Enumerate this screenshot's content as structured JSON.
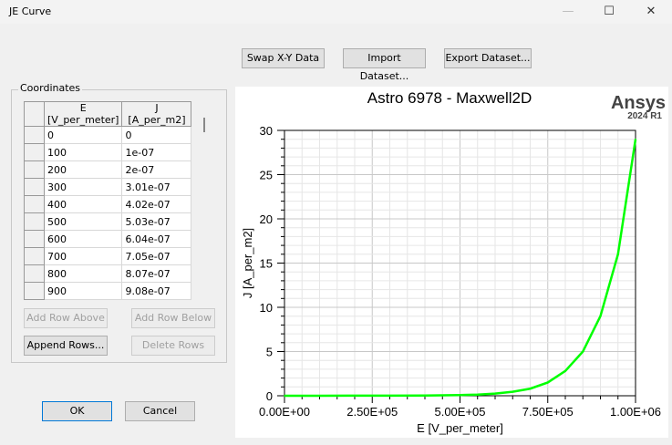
{
  "window": {
    "title": "JE Curve",
    "minimize": "—",
    "maximize": "☐",
    "close": "✕"
  },
  "toolbar": {
    "swap": "Swap X-Y Data",
    "import": "Import Dataset...",
    "export": "Export Dataset..."
  },
  "coordinates": {
    "label": "Coordinates",
    "headers": [
      "E [V_per_meter]",
      "J [A_per_m2]"
    ],
    "rows": [
      [
        "0",
        "0"
      ],
      [
        "100",
        "1e-07"
      ],
      [
        "200",
        "2e-07"
      ],
      [
        "300",
        "3.01e-07"
      ],
      [
        "400",
        "4.02e-07"
      ],
      [
        "500",
        "5.03e-07"
      ],
      [
        "600",
        "6.04e-07"
      ],
      [
        "700",
        "7.05e-07"
      ],
      [
        "800",
        "8.07e-07"
      ],
      [
        "900",
        "9.08e-07"
      ]
    ]
  },
  "buttons": {
    "add_above": "Add Row Above",
    "add_below": "Add Row Below",
    "append": "Append Rows...",
    "delete": "Delete Rows",
    "ok": "OK",
    "cancel": "Cancel"
  },
  "brand": {
    "name": "Ansys",
    "version": "2024 R1"
  },
  "chart_data": {
    "type": "line",
    "title": "Astro 6978 - Maxwell2D",
    "xlabel": "E [V_per_meter]",
    "ylabel": "J [A_per_m2]",
    "xlim": [
      0,
      1000000
    ],
    "ylim": [
      0,
      30
    ],
    "xticks": [
      "0.00E+00",
      "2.50E+05",
      "5.00E+05",
      "7.50E+05",
      "1.00E+06"
    ],
    "yticks": [
      "0",
      "5",
      "10",
      "15",
      "20",
      "25",
      "30"
    ],
    "color": "#00ff00",
    "grid": true,
    "x": [
      0,
      100000,
      200000,
      300000,
      400000,
      500000,
      550000,
      600000,
      650000,
      700000,
      750000,
      800000,
      850000,
      900000,
      950000,
      1000000
    ],
    "y": [
      0,
      0.003,
      0.01,
      0.009,
      0.027,
      0.08,
      0.13,
      0.25,
      0.45,
      0.8,
      1.5,
      2.8,
      5.0,
      9.0,
      16.0,
      29.0
    ]
  }
}
